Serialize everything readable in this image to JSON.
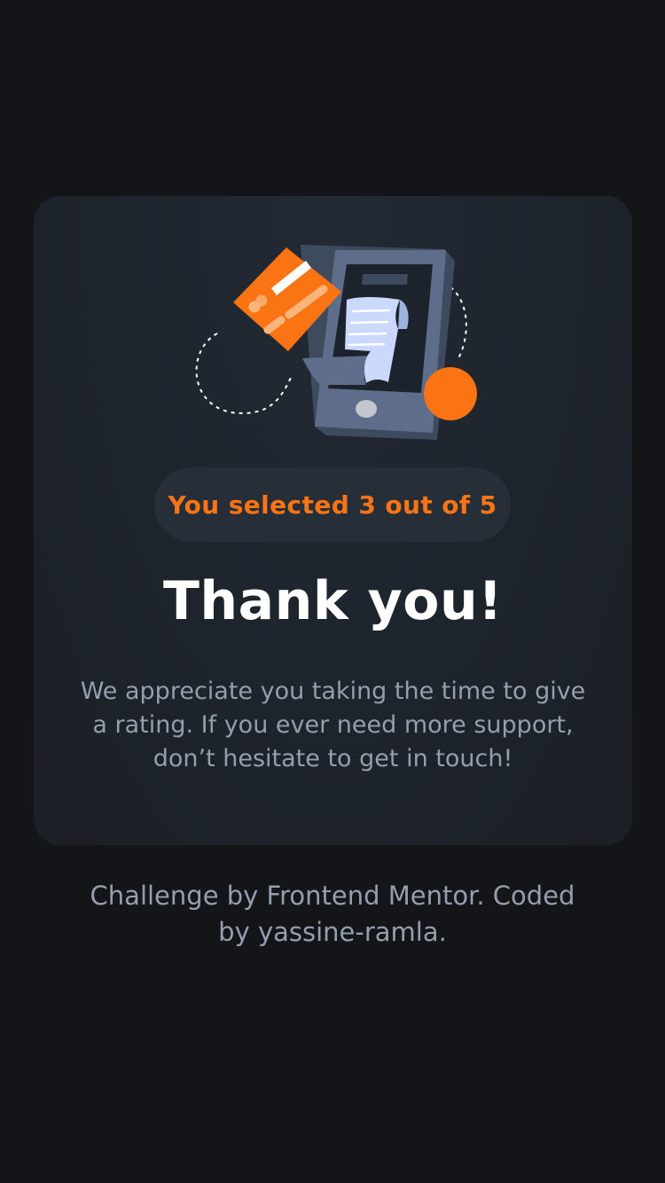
{
  "colors": {
    "page_background": "#131518",
    "card_background": "#1e242c",
    "accent": "#fb7413",
    "heading": "#ffffff",
    "body_text": "#959eac",
    "pill_background": "#262e38"
  },
  "card": {
    "illustration_icon": "payment-receipt-phone-illustration",
    "result": "You selected 3 out of 5",
    "title": "Thank you!",
    "message": "We appreciate you taking the time to give a rating. If you ever need more support, don’t hesitate to get in touch!"
  },
  "footer": {
    "attribution": "Challenge by Frontend Mentor. Coded by yassine-ramla."
  }
}
